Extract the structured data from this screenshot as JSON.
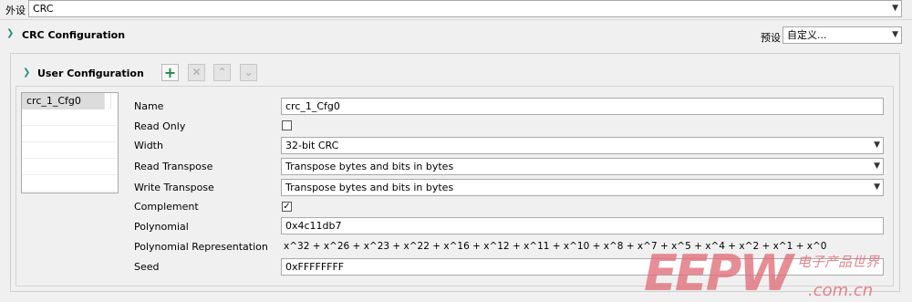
{
  "peripheral": {
    "label": "外设",
    "value": "CRC"
  },
  "crc_section": {
    "title": "CRC Configuration",
    "preset_label": "预设",
    "preset_value": "自定义..."
  },
  "user_config": {
    "title": "User Configuration",
    "toolbar": {
      "add": "+",
      "remove": "✕",
      "up": "⌃",
      "down": "⌄"
    },
    "list_items": [
      "crc_1_Cfg0"
    ]
  },
  "form": {
    "name_label": "Name",
    "name_value": "crc_1_Cfg0",
    "readonly_label": "Read Only",
    "readonly_checked": false,
    "width_label": "Width",
    "width_value": "32-bit CRC",
    "read_transpose_label": "Read Transpose",
    "read_transpose_value": "Transpose bytes and bits in bytes",
    "write_transpose_label": "Write Transpose",
    "write_transpose_value": "Transpose bytes and bits in bytes",
    "complement_label": "Complement",
    "complement_checked": true,
    "polynomial_label": "Polynomial",
    "polynomial_value": "0x4c11db7",
    "poly_repr_label": "Polynomial Representation",
    "poly_repr_value": "x^32 + x^26 + x^23 + x^22 + x^16 + x^12 + x^11 + x^10 + x^8 + x^7 + x^5 + x^4 + x^2 + x^1 + x^0",
    "seed_label": "Seed",
    "seed_value": "0xFFFFFFFF"
  },
  "watermark": {
    "logo": "EEPW",
    "tagline": "电子产品世界",
    "site": ".com.cn"
  },
  "colors": {
    "accent": "#2a8a7e",
    "watermark_red": "#e0707a"
  }
}
